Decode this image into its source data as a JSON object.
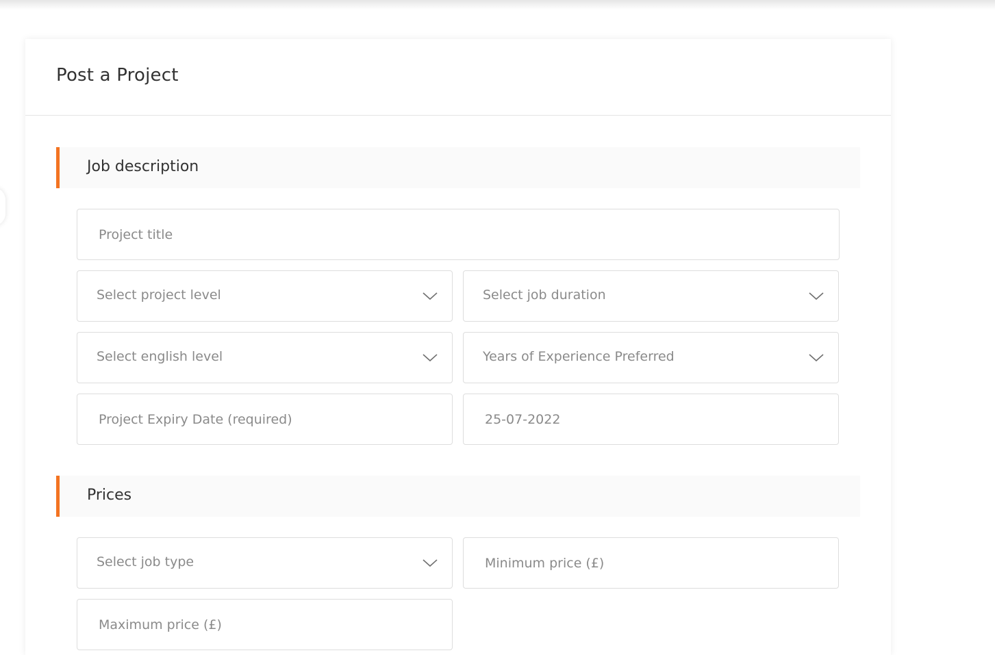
{
  "page": {
    "title": "Post a Project"
  },
  "sections": {
    "job_description": {
      "heading": "Job description",
      "project_title_placeholder": "Project title",
      "project_level": "Select project level",
      "job_duration": "Select job duration",
      "english_level": "Select english level",
      "experience": "Years of Experience Preferred",
      "expiry_placeholder": "Project Expiry Date (required)",
      "expiry_date_value": "25-07-2022"
    },
    "prices": {
      "heading": "Prices",
      "job_type": "Select job type",
      "min_price_placeholder": "Minimum price (£)",
      "max_price_placeholder": "Maximum price (£)"
    }
  },
  "icons": {
    "dropdown": "chevron-down-icon"
  },
  "colors": {
    "accent": "#f37321",
    "text": "#323232",
    "placeholder": "#8a8a8a",
    "border": "#dddddd"
  }
}
